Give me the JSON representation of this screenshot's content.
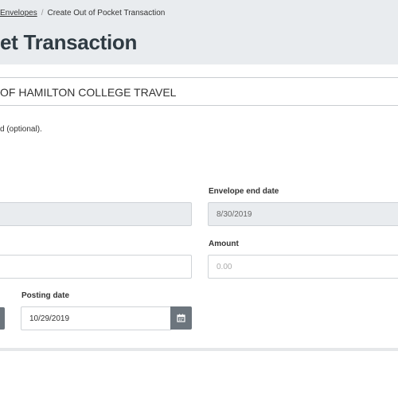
{
  "breadcrumb": {
    "envelopes_link": "Envelopes",
    "separator": "/",
    "current": "Create Out of Pocket Transaction"
  },
  "page_title": "et Transaction",
  "envelope_name": "OF HAMILTON COLLEGE TRAVEL",
  "helper_text": "d (optional).",
  "fields": {
    "envelope_end_date": {
      "label": "Envelope end date",
      "value": "8/30/2019"
    },
    "amount": {
      "label": "Amount",
      "placeholder": "0.00"
    },
    "posting_date": {
      "label": "Posting date",
      "value": "10/29/2019"
    }
  },
  "icons": {
    "calendar": "calendar-icon"
  }
}
